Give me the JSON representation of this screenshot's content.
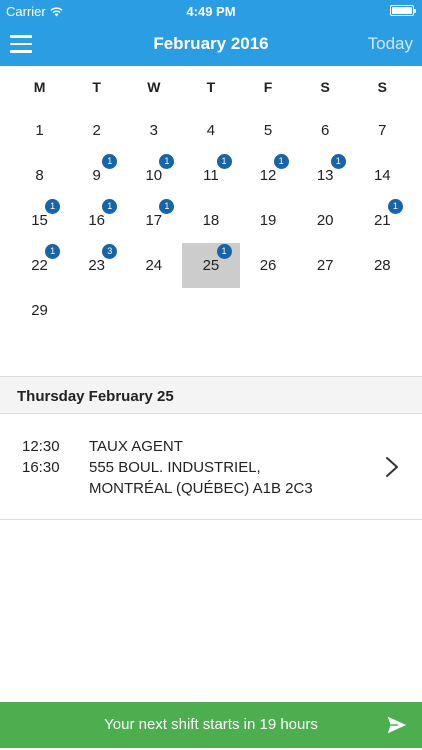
{
  "status_bar": {
    "carrier": "Carrier",
    "time": "4:49 PM"
  },
  "nav": {
    "title": "February 2016",
    "today_label": "Today"
  },
  "weekdays": [
    "M",
    "T",
    "W",
    "T",
    "F",
    "S",
    "S"
  ],
  "calendar": {
    "weeks": [
      [
        {
          "day": "1"
        },
        {
          "day": "2"
        },
        {
          "day": "3"
        },
        {
          "day": "4"
        },
        {
          "day": "5"
        },
        {
          "day": "6"
        },
        {
          "day": "7"
        }
      ],
      [
        {
          "day": "8"
        },
        {
          "day": "9",
          "badge": "1"
        },
        {
          "day": "10",
          "badge": "1"
        },
        {
          "day": "11",
          "badge": "1"
        },
        {
          "day": "12",
          "badge": "1"
        },
        {
          "day": "13",
          "badge": "1"
        },
        {
          "day": "14"
        }
      ],
      [
        {
          "day": "15",
          "badge": "1"
        },
        {
          "day": "16",
          "badge": "1"
        },
        {
          "day": "17",
          "badge": "1"
        },
        {
          "day": "18"
        },
        {
          "day": "19"
        },
        {
          "day": "20"
        },
        {
          "day": "21",
          "badge": "1"
        }
      ],
      [
        {
          "day": "22",
          "badge": "1"
        },
        {
          "day": "23",
          "badge": "3"
        },
        {
          "day": "24"
        },
        {
          "day": "25",
          "badge": "1",
          "selected": true
        },
        {
          "day": "26"
        },
        {
          "day": "27"
        },
        {
          "day": "28"
        }
      ],
      [
        {
          "day": "29"
        },
        {
          "day": ""
        },
        {
          "day": ""
        },
        {
          "day": ""
        },
        {
          "day": ""
        },
        {
          "day": ""
        },
        {
          "day": ""
        }
      ]
    ]
  },
  "selected_date_label": "Thursday February 25",
  "shift": {
    "start": "12:30",
    "end": "16:30",
    "role": "TAUX AGENT",
    "address_line1": "555 BOUL. INDUSTRIEL,",
    "address_line2": "MONTRÉAL (QUÉBEC) A1B 2C3"
  },
  "next_shift": {
    "label": "Your next shift starts in 19 hours"
  },
  "colors": {
    "primary": "#2a9de3",
    "badge": "#1764a8",
    "success": "#4cae4f",
    "selected": "#cccccc"
  }
}
